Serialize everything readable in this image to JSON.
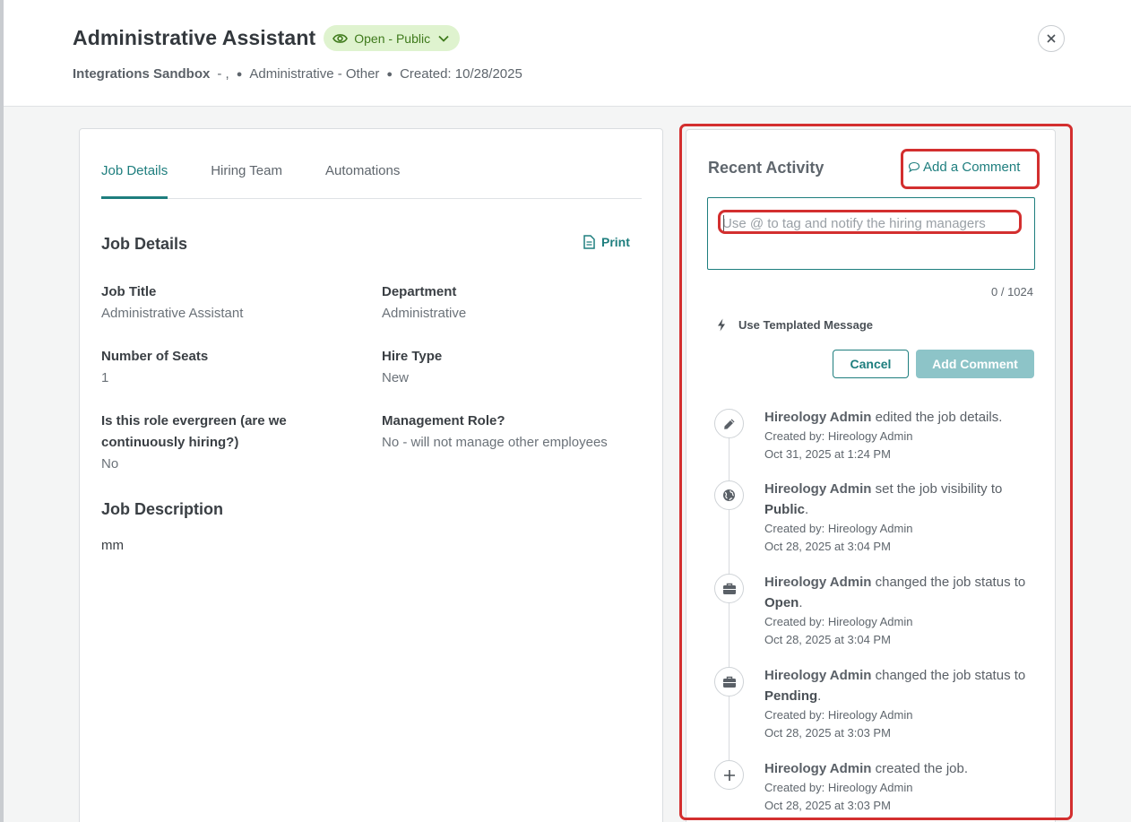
{
  "header": {
    "job_title": "Administrative Assistant",
    "status": "Open - Public",
    "org": "Integrations Sandbox",
    "location_suffix": "- ,",
    "category": "Administrative - Other",
    "created": "Created: 10/28/2025",
    "colors": {
      "accent": "#1e7e7e",
      "status_bg": "#dff3cf",
      "status_text": "#3f7a1c",
      "highlight": "#d32f2f"
    }
  },
  "tabs": [
    {
      "label": "Job Details",
      "active": true
    },
    {
      "label": "Hiring Team",
      "active": false
    },
    {
      "label": "Automations",
      "active": false
    }
  ],
  "details": {
    "section_title": "Job Details",
    "print_label": "Print",
    "fields": [
      {
        "label": "Job Title",
        "value": "Administrative Assistant"
      },
      {
        "label": "Department",
        "value": "Administrative"
      },
      {
        "label": "Number of Seats",
        "value": "1"
      },
      {
        "label": "Hire Type",
        "value": "New"
      },
      {
        "label": "Is this role evergreen (are we continuously hiring?)",
        "value": "No"
      },
      {
        "label": "Management Role?",
        "value": "No - will not manage other employees"
      }
    ],
    "description_title": "Job Description",
    "description": "mm"
  },
  "activity": {
    "title": "Recent Activity",
    "add_comment_link": "Add a Comment",
    "comment_placeholder": "Use @ to tag and notify the hiring managers",
    "char_count": "0 / 1024",
    "templated_label": "Use Templated Message",
    "cancel_label": "Cancel",
    "add_label": "Add Comment",
    "items": [
      {
        "icon": "pencil-icon",
        "who": "Hireology Admin",
        "action": "edited the job details.",
        "emphasis": "",
        "tail": "",
        "created_by": "Created by: Hireology Admin",
        "time": "Oct 31, 2025 at 1:24 PM"
      },
      {
        "icon": "globe-icon",
        "who": "Hireology Admin",
        "action": "set the job visibility to",
        "emphasis": "Public",
        "tail": ".",
        "created_by": "Created by: Hireology Admin",
        "time": "Oct 28, 2025 at 3:04 PM"
      },
      {
        "icon": "briefcase-icon",
        "who": "Hireology Admin",
        "action": "changed the job status to",
        "emphasis": "Open",
        "tail": ".",
        "created_by": "Created by: Hireology Admin",
        "time": "Oct 28, 2025 at 3:04 PM"
      },
      {
        "icon": "briefcase-icon",
        "who": "Hireology Admin",
        "action": "changed the job status to",
        "emphasis": "Pending",
        "tail": ".",
        "created_by": "Created by: Hireology Admin",
        "time": "Oct 28, 2025 at 3:03 PM"
      },
      {
        "icon": "plus-icon",
        "who": "Hireology Admin",
        "action": "created the job.",
        "emphasis": "",
        "tail": "",
        "created_by": "Created by: Hireology Admin",
        "time": "Oct 28, 2025 at 3:03 PM"
      }
    ]
  }
}
